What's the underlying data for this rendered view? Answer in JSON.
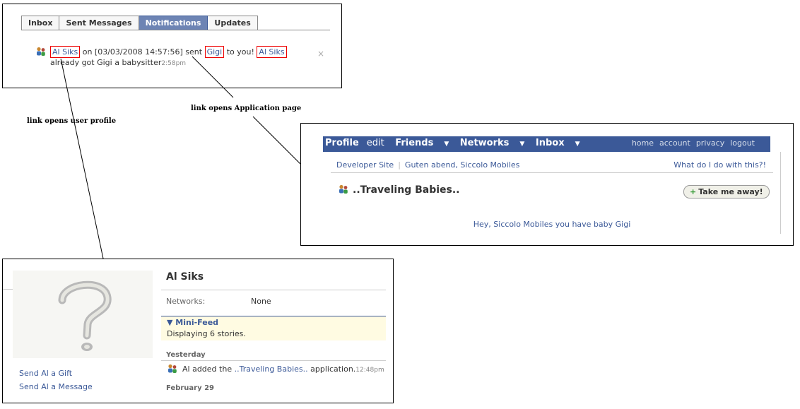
{
  "notifications_panel": {
    "tabs": [
      {
        "label": "Inbox"
      },
      {
        "label": "Sent Messages"
      },
      {
        "label": "Notifications",
        "active": true
      },
      {
        "label": "Updates"
      }
    ],
    "notification": {
      "user1": "Al Siks",
      "text1": " on [03/03/2008 14:57:56] sent ",
      "gift": "Gigi",
      "text2": " to you! ",
      "user2": "Al Siks",
      "text3": " already got Gigi a babysitter",
      "time": "2:58pm",
      "close": "×"
    }
  },
  "annotations": {
    "user_profile": "link opens user profile",
    "application_page": "link opens Application page"
  },
  "app_page": {
    "nav_left": {
      "profile": "Profile",
      "edit": "edit",
      "friends": "Friends",
      "networks": "Networks",
      "inbox": "Inbox",
      "caret": "▼"
    },
    "nav_right": [
      "home",
      "account",
      "privacy",
      "logout"
    ],
    "subnav": {
      "developer_site": "Developer Site",
      "separator": "|",
      "greeting": "Guten abend, Siccolo Mobiles",
      "help": "What do I do with this?!"
    },
    "title": "..Traveling Babies..",
    "button": {
      "plus": "+",
      "label": "Take me away!"
    },
    "message": "Hey, Siccolo Mobiles you have baby Gigi"
  },
  "profile_page": {
    "name": "Al Siks",
    "networks_label": "Networks:",
    "networks_value": "None",
    "minifeed_title": "▼ Mini-Feed",
    "displaying": "Displaying 6 stories.",
    "yesterday": "Yesterday",
    "story": {
      "prefix": "Al added the ",
      "app": "..Traveling Babies..",
      "suffix": " application.",
      "time": "12:48pm"
    },
    "february": "February 29",
    "send_gift": "Send Al a Gift",
    "send_message": "Send Al a Message"
  }
}
